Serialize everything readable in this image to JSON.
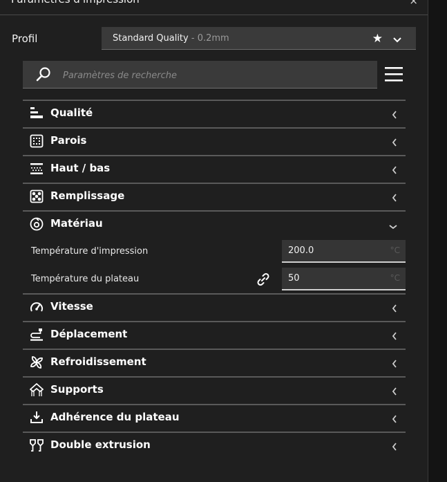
{
  "panel": {
    "title": "Paramètres d'impression",
    "close": "×"
  },
  "profile": {
    "label": "Profil",
    "name": "Standard Quality",
    "suffix": " - 0.2mm"
  },
  "search": {
    "placeholder": "Paramètres de recherche"
  },
  "categories": [
    {
      "label": "Qualité",
      "icon": "quality-icon",
      "state": "collapsed"
    },
    {
      "label": "Parois",
      "icon": "walls-icon",
      "state": "collapsed"
    },
    {
      "label": "Haut / bas",
      "icon": "top-bottom-icon",
      "state": "collapsed"
    },
    {
      "label": "Remplissage",
      "icon": "infill-icon",
      "state": "collapsed"
    },
    {
      "label": "Matériau",
      "icon": "material-icon",
      "state": "expanded"
    },
    {
      "label": "Vitesse",
      "icon": "speed-icon",
      "state": "collapsed"
    },
    {
      "label": "Déplacement",
      "icon": "travel-icon",
      "state": "collapsed"
    },
    {
      "label": "Refroidissement",
      "icon": "cooling-icon",
      "state": "collapsed"
    },
    {
      "label": "Supports",
      "icon": "support-icon",
      "state": "collapsed"
    },
    {
      "label": "Adhérence du plateau",
      "icon": "adhesion-icon",
      "state": "collapsed"
    },
    {
      "label": "Double extrusion",
      "icon": "dual-extrusion-icon",
      "state": "collapsed"
    }
  ],
  "material_settings": [
    {
      "label": "Température d'impression",
      "value": "200.0",
      "unit": "°C"
    },
    {
      "label": "Température du plateau",
      "value": "50",
      "unit": "°C"
    }
  ],
  "colors": {
    "panel_bg": "#1f1f1f",
    "field_bg": "#3a3a3a",
    "divider": "#5a5a5a"
  }
}
